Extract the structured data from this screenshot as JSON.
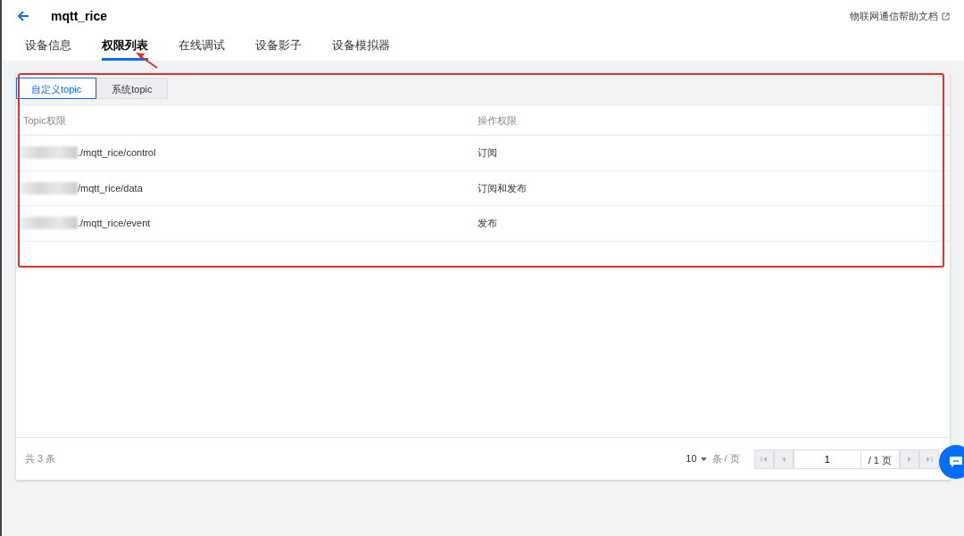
{
  "header": {
    "title": "mqtt_rice",
    "help_link": "物联网通信帮助文档"
  },
  "tabs": [
    {
      "label": "设备信息",
      "selected": false
    },
    {
      "label": "权限列表",
      "selected": true
    },
    {
      "label": "在线调试",
      "selected": false
    },
    {
      "label": "设备影子",
      "selected": false
    },
    {
      "label": "设备模拟器",
      "selected": false
    }
  ],
  "sub_tabs": [
    {
      "label": "自定义topic",
      "selected": true
    },
    {
      "label": "系统topic",
      "selected": false
    }
  ],
  "table": {
    "columns": [
      "Topic权限",
      "操作权限"
    ],
    "rows": [
      {
        "topic": "./mqtt_rice/control",
        "permission": "订阅"
      },
      {
        "topic": "/mqtt_rice/data",
        "permission": "订阅和发布"
      },
      {
        "topic": "./mqtt_rice/event",
        "permission": "发布"
      }
    ]
  },
  "footer": {
    "total": "共 3 条",
    "page_size": "10",
    "per_page": "条 / 页",
    "page": "1",
    "page_count": "/ 1 页"
  }
}
